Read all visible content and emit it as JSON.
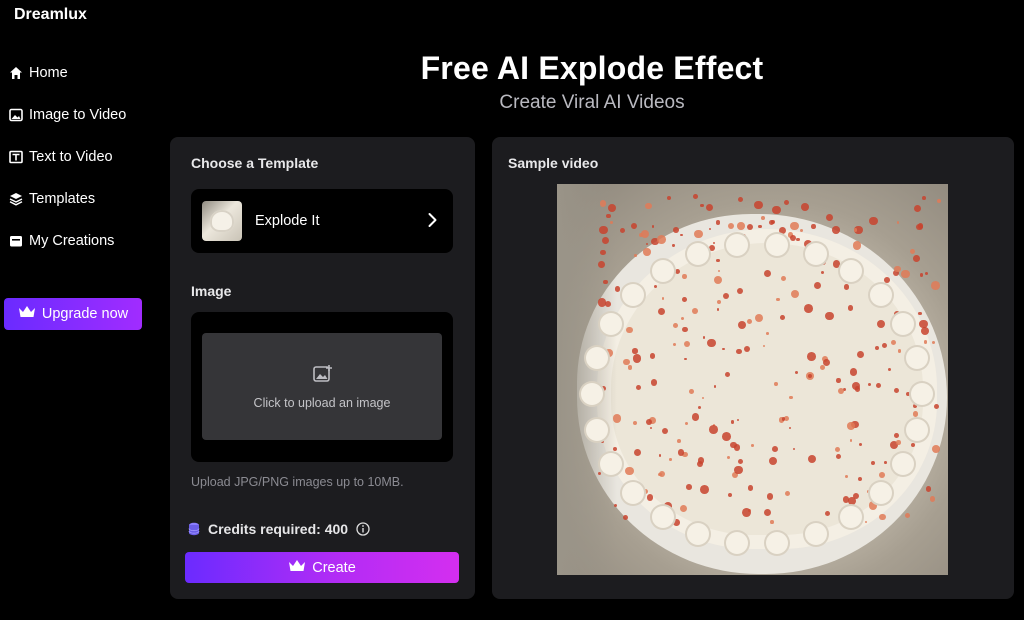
{
  "brand": "Dreamlux",
  "nav": [
    {
      "label": "Home",
      "icon": "home-icon"
    },
    {
      "label": "Image to Video",
      "icon": "image-icon"
    },
    {
      "label": "Text to Video",
      "icon": "text-icon"
    },
    {
      "label": "Templates",
      "icon": "layers-icon"
    },
    {
      "label": "My Creations",
      "icon": "folder-icon"
    }
  ],
  "upgrade_label": "Upgrade now",
  "hero": {
    "title": "Free AI Explode Effect",
    "subtitle": "Create Viral AI Videos"
  },
  "left_panel": {
    "template_heading": "Choose a Template",
    "template_name": "Explode It",
    "image_heading": "Image",
    "upload_text": "Click to upload an image",
    "upload_hint": "Upload JPG/PNG images up to 10MB.",
    "credits_text": "Credits required: 400",
    "create_label": "Create"
  },
  "right_panel": {
    "heading": "Sample video"
  },
  "colors": {
    "accent_start": "#6a2bff",
    "accent_end": "#d42ef0",
    "panel": "#1c1c1f"
  }
}
